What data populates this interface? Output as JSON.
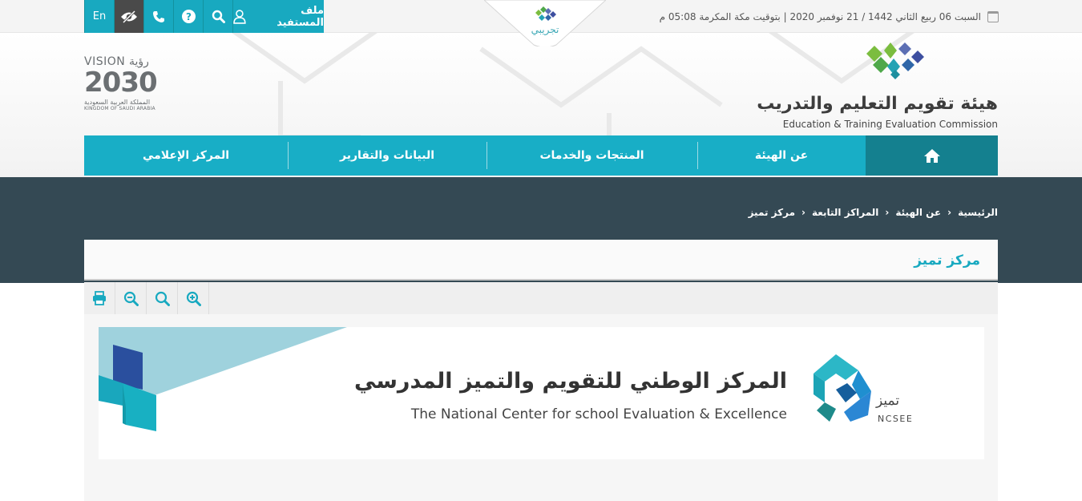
{
  "topbar": {
    "date_text": "السبت 06 ربيع الثاني 1442 / 21 نوفمبر 2020 | بتوقيت مكة المكرمة 05:08 م",
    "profile_label": "ملف المستفيد",
    "lang_label": "En"
  },
  "sandbox_label": "تجريبي",
  "org": {
    "name_ar": "هيئة تقويم التعليم والتدريب",
    "name_en": "Education & Training Evaluation Commission"
  },
  "vision": {
    "word": "VISION",
    "word_ar": "رؤية",
    "year": "2030",
    "kingdom_ar": "المملكة العربية السعودية",
    "kingdom_en": "KINGDOM OF SAUDI ARABIA"
  },
  "nav": {
    "items": [
      {
        "label": "عن الهيئة"
      },
      {
        "label": "المنتجات والخدمات"
      },
      {
        "label": "البيانات والتقارير"
      },
      {
        "label": "المركز الإعلامي"
      }
    ]
  },
  "breadcrumb": [
    "الرئيسية",
    "عن الهيئة",
    "المراكز التابعة",
    "مركز تميز"
  ],
  "page_title": "مركز تميز",
  "banner": {
    "title_ar": "المركز الوطني للتقويم والتميز المدرسي",
    "title_en": "The National Center for school Evaluation & Excellence",
    "name_ar": "تميز",
    "name_en": "NCSEE"
  },
  "colors": {
    "primary": "#18aec6",
    "primary_dark": "#14808f",
    "band": "#344954"
  }
}
